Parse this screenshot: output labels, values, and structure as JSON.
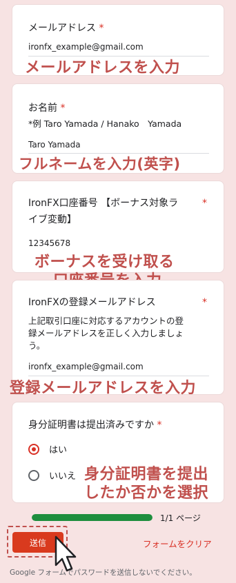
{
  "q1": {
    "title": "メールアドレス",
    "required_mark": "*",
    "answer": "ironfx_example@gmail.com",
    "overlay": "メールアドレスを入力"
  },
  "q2": {
    "title": "お名前",
    "required_mark": "*",
    "description": "*例 Taro Yamada / Hanako　Yamada",
    "answer": "Taro Yamada",
    "overlay": "フルネームを入力(英字)"
  },
  "q3": {
    "title_line1": "IronFX口座番号 【ボーナス対象ラ",
    "title_line2": "イブ変動】",
    "required_mark": "*",
    "answer": "12345678",
    "overlay_line1": "ボーナスを受け取る",
    "overlay_line2": "口座番号を入力"
  },
  "q4": {
    "title": "IronFXの登録メールアドレス",
    "required_mark": "*",
    "description_line1": "上記取引口座に対応するアカウントの登",
    "description_line2": "録メールアドレスを正しく入力しましょ",
    "description_line3": "う。",
    "answer": "ironfx_example@gmail.com",
    "overlay": "登録メールアドレスを入力"
  },
  "q5": {
    "title": "身分証明書は提出済みですか",
    "required_mark": "*",
    "options": [
      "はい",
      "いいえ"
    ],
    "selected": "はい",
    "overlay_line1": "身分証明書を提出",
    "overlay_line2": "したか否かを選択"
  },
  "progress": {
    "value": 1.0,
    "label": "1/1 ページ"
  },
  "buttons": {
    "submit": "送信",
    "clear": "フォームをクリア"
  },
  "footer": "Google フォームでパスワードを送信しないでください。",
  "colors": {
    "accent": "#d93025",
    "overlay_text": "#c0504d",
    "progress": "#1e8e3e",
    "background": "#f7e3e3"
  }
}
